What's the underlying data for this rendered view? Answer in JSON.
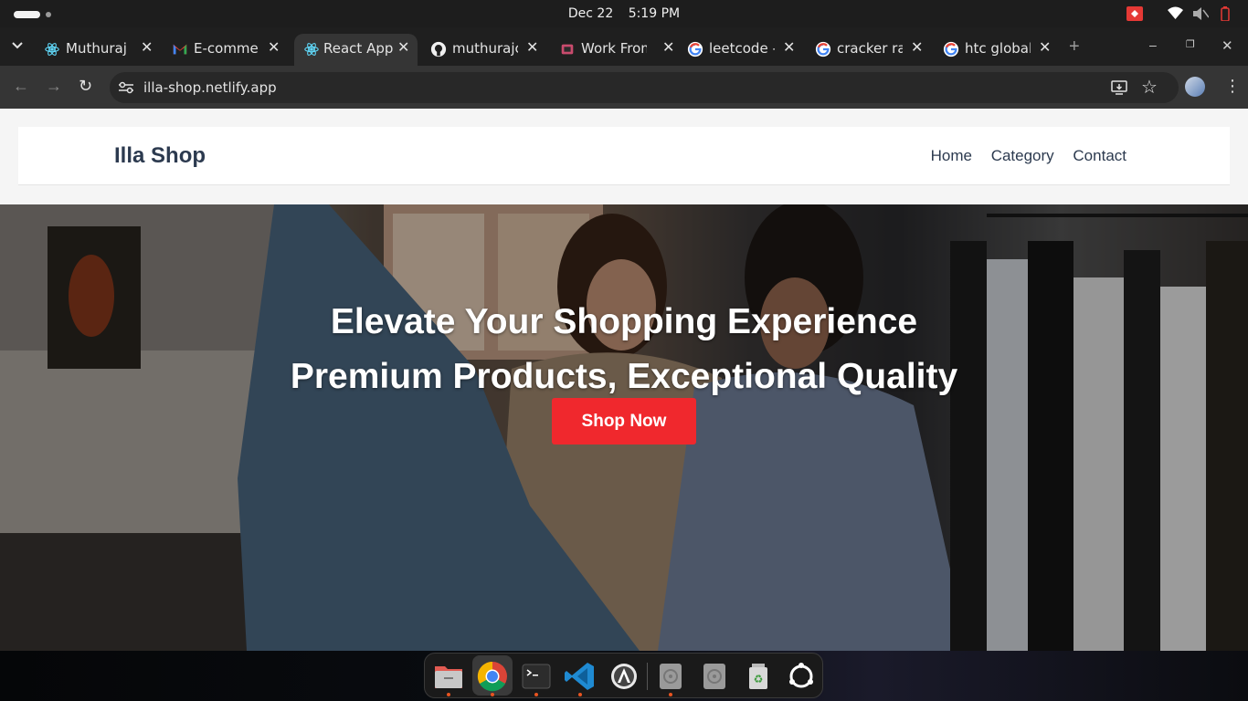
{
  "system": {
    "date": "Dec 22",
    "time": "5:19 PM"
  },
  "tabs": [
    {
      "label": "Muthuraj C",
      "icon": "react-icon"
    },
    {
      "label": "E-commerc",
      "icon": "gmail-icon"
    },
    {
      "label": "React App",
      "icon": "react-icon",
      "active": true
    },
    {
      "label": "muthurajc",
      "icon": "github-icon"
    },
    {
      "label": "Work From",
      "icon": "work-icon"
    },
    {
      "label": "leetcode -",
      "icon": "google-icon"
    },
    {
      "label": "cracker rar",
      "icon": "google-icon"
    },
    {
      "label": "htc global",
      "icon": "google-icon"
    }
  ],
  "toolbar": {
    "url": "illa-shop.netlify.app"
  },
  "site": {
    "brand": "Illa Shop",
    "nav": [
      "Home",
      "Category",
      "Contact"
    ],
    "hero_title": "Elevate Your Shopping Experience",
    "hero_subtitle": "Premium Products, Exceptional Quality",
    "cta_label": "Shop Now"
  },
  "colors": {
    "accent": "#f0282d",
    "brand_text": "#2c3a4f"
  },
  "dock": [
    "files-icon",
    "chrome-icon",
    "terminal-icon",
    "vscode-icon",
    "software-center-icon",
    "disk-icon",
    "disk-icon",
    "trash-icon",
    "apps-grid-icon"
  ]
}
